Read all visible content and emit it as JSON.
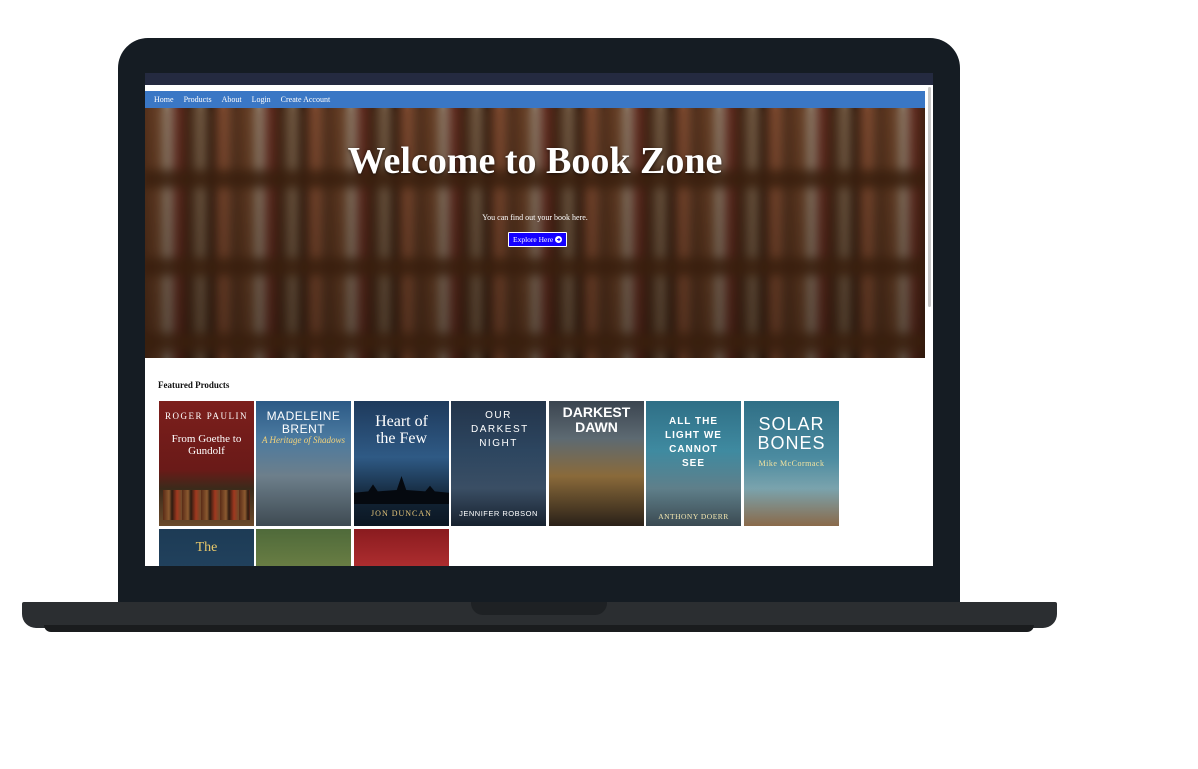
{
  "navbar": {
    "items": [
      "Home",
      "Products",
      "About",
      "Login",
      "Create Account"
    ]
  },
  "hero": {
    "title": "Welcome to Book Zone",
    "subtitle": "You can find out your book here.",
    "button_label": "Explore Here",
    "button_icon": "arrow-circle-right-icon",
    "background": "blurred-bookshelf"
  },
  "featured": {
    "heading": "Featured Products",
    "books": [
      {
        "title": "From Goethe to Gundolf",
        "author": "ROGER PAULIN"
      },
      {
        "title": "A Heritage of Shadows",
        "author": "MADELEINE BRENT"
      },
      {
        "title": "Heart of the Few",
        "author": "JON DUNCAN"
      },
      {
        "title": "OUR DARKEST NIGHT",
        "author": "JENNIFER ROBSON"
      },
      {
        "title": "DARKEST DAWN",
        "author": ""
      },
      {
        "title": "ALL THE LIGHT WE CANNOT SEE",
        "author": "ANTHONY DOERR"
      },
      {
        "title": "SOLAR BONES",
        "author": "Mike McCormack"
      },
      {
        "title": "The",
        "author": ""
      },
      {
        "title": "",
        "author": ""
      },
      {
        "title": "",
        "author": ""
      }
    ]
  },
  "colors": {
    "navbar": "#3a77c5",
    "button": "#1400ff",
    "laptop_frame": "#151c23"
  }
}
